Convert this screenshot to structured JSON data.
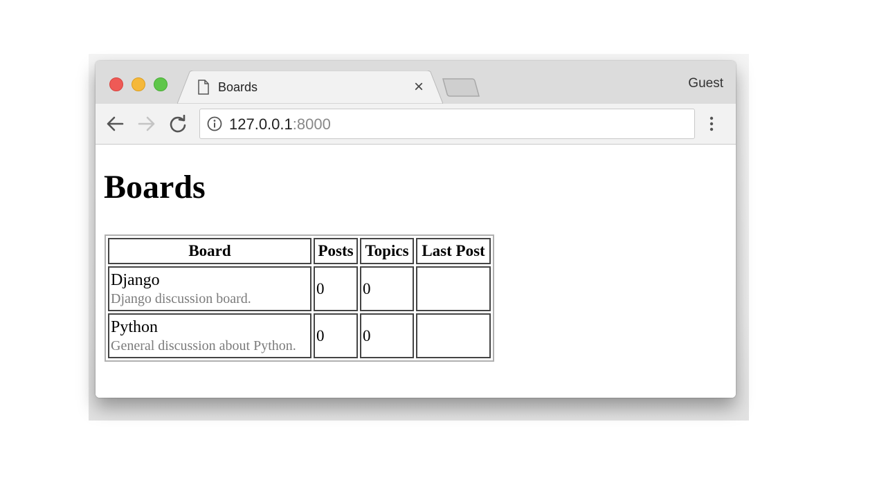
{
  "browser": {
    "tab_title": "Boards",
    "profile_label": "Guest",
    "address": {
      "host": "127.0.0.1",
      "port": ":8000"
    }
  },
  "page": {
    "heading": "Boards",
    "table": {
      "headers": [
        "Board",
        "Posts",
        "Topics",
        "Last Post"
      ],
      "rows": [
        {
          "name": "Django",
          "description": "Django discussion board.",
          "posts": "0",
          "topics": "0",
          "last_post": ""
        },
        {
          "name": "Python",
          "description": "General discussion about Python.",
          "posts": "0",
          "topics": "0",
          "last_post": ""
        }
      ]
    }
  },
  "colors": {
    "close": "#ee5a56",
    "minimize": "#f5b83a",
    "maximize": "#5fc64a",
    "description_text": "#7b7b7b"
  }
}
